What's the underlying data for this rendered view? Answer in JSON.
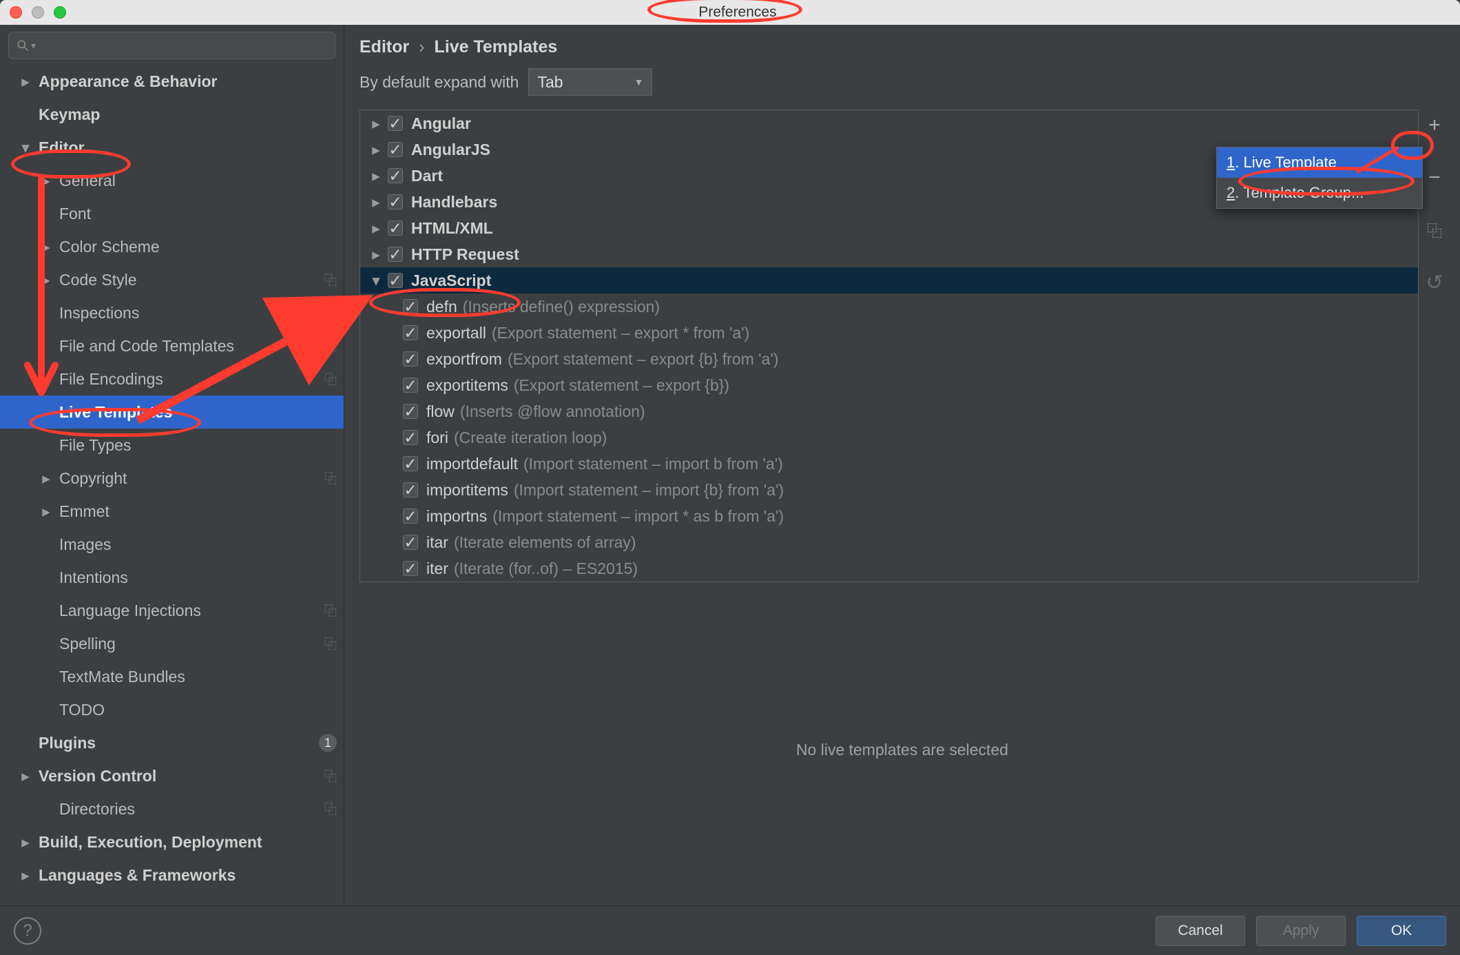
{
  "window": {
    "title": "Preferences"
  },
  "breadcrumb": {
    "root": "Editor",
    "leaf": "Live Templates"
  },
  "expand": {
    "label": "By default expand with",
    "value": "Tab"
  },
  "sidebar": {
    "items": [
      {
        "label": "Appearance & Behavior",
        "bold": true,
        "arrow": "right"
      },
      {
        "label": "Keymap",
        "bold": true
      },
      {
        "label": "Editor",
        "bold": true,
        "arrow": "down"
      },
      {
        "label": "General",
        "indent": 1,
        "arrow": "right"
      },
      {
        "label": "Font",
        "indent": 1
      },
      {
        "label": "Color Scheme",
        "indent": 1,
        "arrow": "right"
      },
      {
        "label": "Code Style",
        "indent": 1,
        "arrow": "right",
        "overlay": true
      },
      {
        "label": "Inspections",
        "indent": 1,
        "overlay": true
      },
      {
        "label": "File and Code Templates",
        "indent": 1,
        "overlay": true
      },
      {
        "label": "File Encodings",
        "indent": 1,
        "overlay": true
      },
      {
        "label": "Live Templates",
        "indent": 1,
        "selected": true
      },
      {
        "label": "File Types",
        "indent": 1
      },
      {
        "label": "Copyright",
        "indent": 1,
        "arrow": "right",
        "overlay": true
      },
      {
        "label": "Emmet",
        "indent": 1,
        "arrow": "right"
      },
      {
        "label": "Images",
        "indent": 1
      },
      {
        "label": "Intentions",
        "indent": 1
      },
      {
        "label": "Language Injections",
        "indent": 1,
        "overlay": true
      },
      {
        "label": "Spelling",
        "indent": 1,
        "overlay": true
      },
      {
        "label": "TextMate Bundles",
        "indent": 1
      },
      {
        "label": "TODO",
        "indent": 1
      },
      {
        "label": "Plugins",
        "bold": true,
        "badge": "1"
      },
      {
        "label": "Version Control",
        "bold": true,
        "arrow": "right",
        "overlay": true
      },
      {
        "label": "Directories",
        "indent": 1,
        "overlay": true
      },
      {
        "label": "Build, Execution, Deployment",
        "bold": true,
        "arrow": "right"
      },
      {
        "label": "Languages & Frameworks",
        "bold": true,
        "arrow": "right"
      }
    ]
  },
  "tree": {
    "groups": [
      {
        "label": "Angular",
        "expanded": false
      },
      {
        "label": "AngularJS",
        "expanded": false
      },
      {
        "label": "Dart",
        "expanded": false
      },
      {
        "label": "Handlebars",
        "expanded": false
      },
      {
        "label": "HTML/XML",
        "expanded": false
      },
      {
        "label": "HTTP Request",
        "expanded": false
      },
      {
        "label": "JavaScript",
        "expanded": true,
        "selected": true
      }
    ],
    "children": [
      {
        "label": "defn",
        "desc": "(Inserts define() expression)"
      },
      {
        "label": "exportall",
        "desc": "(Export statement – export * from 'a')"
      },
      {
        "label": "exportfrom",
        "desc": "(Export statement – export {b} from 'a')"
      },
      {
        "label": "exportitems",
        "desc": "(Export statement – export {b})"
      },
      {
        "label": "flow",
        "desc": "(Inserts @flow annotation)"
      },
      {
        "label": "fori",
        "desc": "(Create iteration loop)"
      },
      {
        "label": "importdefault",
        "desc": "(Import statement – import b from 'a')"
      },
      {
        "label": "importitems",
        "desc": "(Import statement – import {b} from 'a')"
      },
      {
        "label": "importns",
        "desc": "(Import statement – import * as b from 'a')"
      },
      {
        "label": "itar",
        "desc": "(Iterate elements of array)"
      },
      {
        "label": "iter",
        "desc": "(Iterate (for..of) – ES2015)"
      }
    ]
  },
  "popup": {
    "items": [
      {
        "prefix": "1",
        "label": "Live Template",
        "selected": true
      },
      {
        "prefix": "2",
        "label": "Template Group..."
      }
    ]
  },
  "tools": {
    "add": "+",
    "remove": "−",
    "copy": "⿻",
    "undo": "↺"
  },
  "empty_message": "No live templates are selected",
  "footer": {
    "cancel": "Cancel",
    "apply": "Apply",
    "ok": "OK"
  }
}
